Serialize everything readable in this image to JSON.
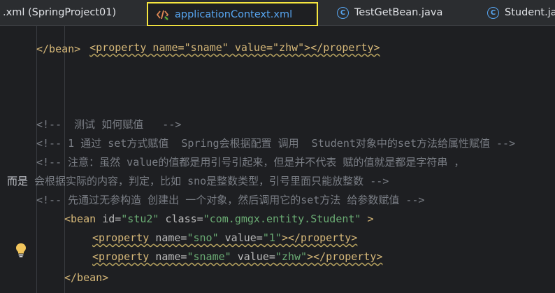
{
  "tabs": [
    {
      "label": ".xml (SpringProject01)",
      "icon": "xml-file-icon",
      "active": false
    },
    {
      "label": "applicationContext.xml",
      "icon": "xml-file-icon",
      "active": true
    },
    {
      "label": "TestGetBean.java",
      "icon": "java-class-icon",
      "active": false
    },
    {
      "label": "Student.ja",
      "icon": "java-class-icon",
      "active": false
    }
  ],
  "code": {
    "line0": {
      "open": "<property name=\"sname\" value=\"zhw\"></property>"
    },
    "line1": {
      "text": "</bean>"
    },
    "line2": {
      "text": "<!--  测试 如何赋值   -->"
    },
    "line3": {
      "text": "<!-- 1 通过 set方式赋值  Spring会根据配置 调用  Student对象中的set方法给属性赋值 -->"
    },
    "line4": {
      "text": "<!-- 注意：虽然 value的值都是用引号引起来，但是并不代表 赋的值就是都是字符串 ，"
    },
    "line5": {
      "prefix": "而是",
      "text": " 会根据实际的内容，判定，比如 sno是整数类型，引号里面只能放整数 -->"
    },
    "line6": {
      "text": "<!-- 先通过无参构造 创建出 一个对象，然后调用它的set方法 给参数赋值 -->"
    },
    "line7": {
      "t1": "<bean ",
      "a1": "id=",
      "s1": "\"stu2\"",
      "a2": " class=",
      "s2": "\"com.gmgx.entity.Student\"",
      "t2": " >"
    },
    "line8": {
      "t1": "<property ",
      "a1": "name=",
      "s1": "\"sno\"",
      "a2": " value=",
      "s2": "\"1\"",
      "t2": "></property>"
    },
    "line9": {
      "t1": "<property ",
      "a1": "name=",
      "s1": "\"sname\"",
      "a2": " value=",
      "s2": "\"zhw\"",
      "t2": "></property>"
    },
    "line10": {
      "text": "</bean>"
    }
  },
  "colors": {
    "tag": "#d5b778",
    "attribute": "#bababa",
    "string": "#6aab73",
    "comment": "#7a7e85",
    "active_tab_border": "#f5e53f",
    "active_tab_text": "#57a6f2"
  },
  "gutter_icon": "lightbulb-icon"
}
